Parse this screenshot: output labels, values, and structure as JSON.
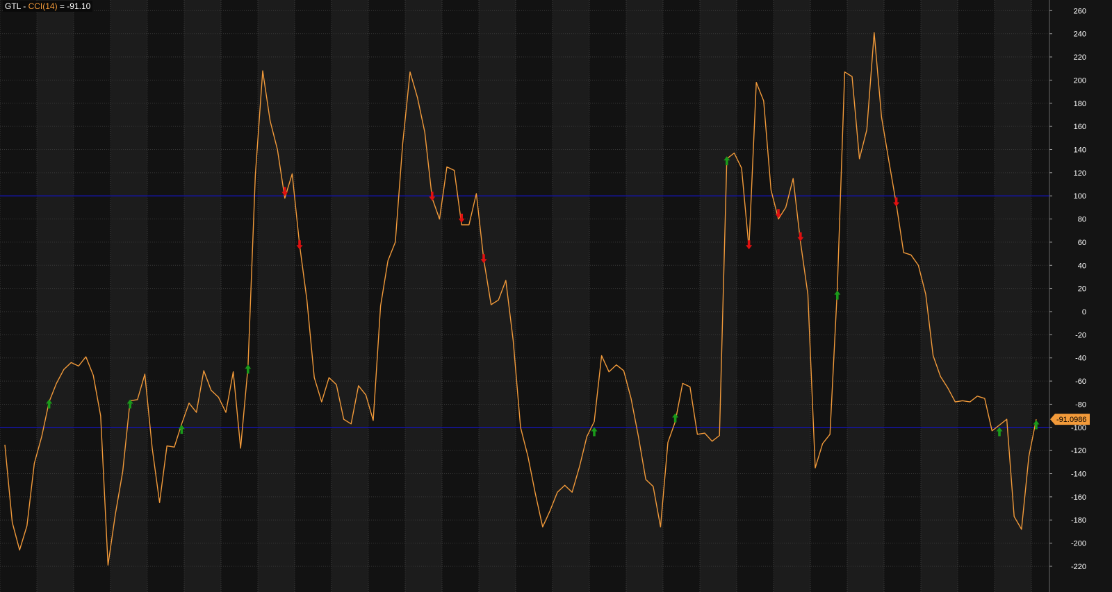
{
  "header": {
    "symbol": "GTL",
    "sep1": " - ",
    "indicator": "CCI(14)",
    "sep2": " = ",
    "value": "-91.10"
  },
  "last_value_tag": "-91.0986",
  "colors": {
    "line": "#f29a3a",
    "ref_line": "#1414a8",
    "buy_arrow": "#1a9a1a",
    "sell_arrow": "#e01010",
    "tag_bg": "#f29a3a",
    "axis_text": "#ffffff"
  },
  "chart_data": {
    "type": "line",
    "title": "",
    "xlabel": "",
    "ylabel": "",
    "ylim": [
      -225,
      265
    ],
    "yticks": [
      260,
      240,
      220,
      200,
      180,
      160,
      140,
      120,
      100,
      80,
      60,
      40,
      20,
      0,
      -20,
      -40,
      -60,
      -80,
      -100,
      -120,
      -140,
      -160,
      -180,
      -200,
      -220
    ],
    "ref_levels": [
      100,
      -100
    ],
    "grid": true,
    "x": [
      0,
      1,
      2,
      3,
      4,
      5,
      6,
      7,
      8,
      9,
      10,
      11,
      12,
      13,
      14,
      15,
      16,
      17,
      18,
      19,
      20,
      21,
      22,
      23,
      24,
      25,
      26,
      27,
      28,
      29,
      30,
      31,
      32,
      33,
      34,
      35,
      36,
      37,
      38,
      39,
      40,
      41,
      42,
      43,
      44,
      45,
      46,
      47,
      48,
      49,
      50,
      51,
      52,
      53,
      54,
      55,
      56,
      57,
      58,
      59,
      60,
      61,
      62,
      63,
      64,
      65,
      66,
      67,
      68,
      69,
      70,
      71,
      72,
      73,
      74,
      75,
      76,
      77,
      78,
      79,
      80,
      81,
      82,
      83,
      84,
      85,
      86,
      87,
      88,
      89,
      90,
      91,
      92,
      93,
      94,
      95,
      96,
      97,
      98,
      99,
      100,
      101,
      102,
      103,
      104,
      105,
      106,
      107,
      108,
      109,
      110,
      111,
      112,
      113,
      114,
      115,
      116,
      117,
      118,
      119,
      120,
      121,
      122,
      123,
      124,
      125,
      126,
      127,
      128,
      129,
      130,
      131,
      132,
      133,
      134,
      135,
      136,
      137,
      138,
      139,
      140,
      141,
      142
    ],
    "series": [
      {
        "values": [
          -115,
          -182,
          -206,
          -185,
          -131,
          -108,
          -78,
          -62,
          -50,
          -44,
          -47,
          -39,
          -55,
          -90,
          -219,
          -175,
          -138,
          -77,
          -76,
          -54,
          -118,
          -165,
          -116,
          -117,
          -97,
          -79,
          -87,
          -51,
          -68,
          -74,
          -87,
          -52,
          -118,
          -48,
          118,
          208,
          165,
          140,
          98,
          119,
          58,
          10,
          -57,
          -78,
          -57,
          -63,
          -93,
          -97,
          -64,
          -72,
          -94,
          5,
          44,
          60,
          145,
          207,
          185,
          155,
          98,
          80,
          125,
          122,
          75,
          75,
          102,
          45,
          6,
          10,
          27,
          -25,
          -100,
          -125,
          -157,
          -186,
          -172,
          -156,
          -150,
          -156,
          -134,
          -108,
          -95,
          -38,
          -52,
          -46,
          -51,
          -75,
          -108,
          -145,
          -151,
          -186,
          -113,
          -95,
          -62,
          -65,
          -106,
          -105,
          -112,
          -107,
          132,
          137,
          124,
          55,
          198,
          182,
          105,
          80,
          90,
          115,
          60,
          15,
          -135,
          -114,
          -106,
          20,
          207,
          203,
          132,
          157,
          241,
          168,
          130,
          93,
          51,
          49,
          40,
          15,
          -38,
          -56,
          -66,
          -78,
          -77,
          -78,
          -73,
          -75,
          -103,
          -98,
          -93,
          -177,
          -188,
          -125,
          -93
        ]
      }
    ],
    "signals": [
      {
        "x": 6,
        "y": -80,
        "type": "buy"
      },
      {
        "x": 17,
        "y": -80,
        "type": "buy"
      },
      {
        "x": 24,
        "y": -102,
        "type": "buy"
      },
      {
        "x": 33,
        "y": -50,
        "type": "buy"
      },
      {
        "x": 38,
        "y": 104,
        "type": "sell"
      },
      {
        "x": 40,
        "y": 58,
        "type": "sell"
      },
      {
        "x": 58,
        "y": 100,
        "type": "sell"
      },
      {
        "x": 62,
        "y": 81,
        "type": "sell"
      },
      {
        "x": 65,
        "y": 46,
        "type": "sell"
      },
      {
        "x": 80,
        "y": -104,
        "type": "buy"
      },
      {
        "x": 91,
        "y": -92,
        "type": "buy"
      },
      {
        "x": 98,
        "y": 130,
        "type": "buy"
      },
      {
        "x": 101,
        "y": 58,
        "type": "sell"
      },
      {
        "x": 105,
        "y": 85,
        "type": "sell"
      },
      {
        "x": 108,
        "y": 65,
        "type": "sell"
      },
      {
        "x": 113,
        "y": 14,
        "type": "buy"
      },
      {
        "x": 121,
        "y": 95,
        "type": "sell"
      },
      {
        "x": 135,
        "y": -104,
        "type": "buy"
      },
      {
        "x": 140,
        "y": -98,
        "type": "buy"
      }
    ]
  }
}
